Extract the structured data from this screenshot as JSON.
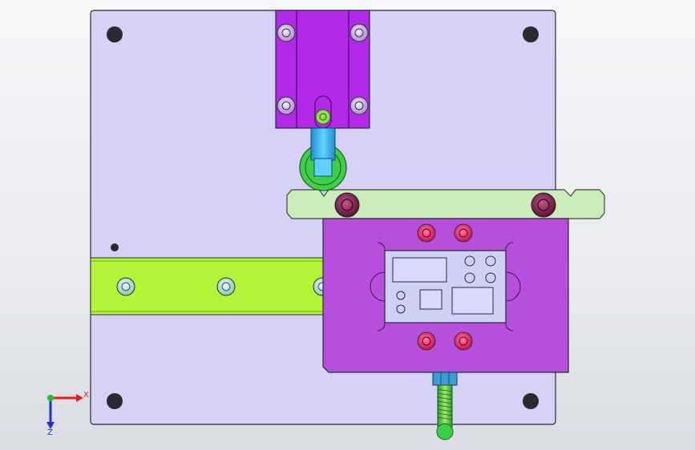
{
  "viewport": {
    "background_top": "#f6f7f9",
    "background_bottom": "#d9dce2"
  },
  "colors": {
    "base_plate": "#d6d2f6",
    "cylinder_block": "#b229ea",
    "rod": "#36b7f0",
    "roller": "#3ecf48",
    "slider_bar": "#c9ecb8",
    "fixture_block": "#b74fdc",
    "rail": "#b4f53a",
    "bolt_red": "#e8175f",
    "bolt_dark": "#7a1a4a",
    "bolt_lavender": "#c9a9e9",
    "part_window": "#cfd0f6",
    "spring_green": "#74d94a",
    "nut_blue": "#3c9cd8"
  },
  "axis_triad": {
    "x_label": "X",
    "y_label": "Z",
    "x_color": "#e02020",
    "y_color": "#2030d0",
    "origin_color": "#20c030"
  }
}
